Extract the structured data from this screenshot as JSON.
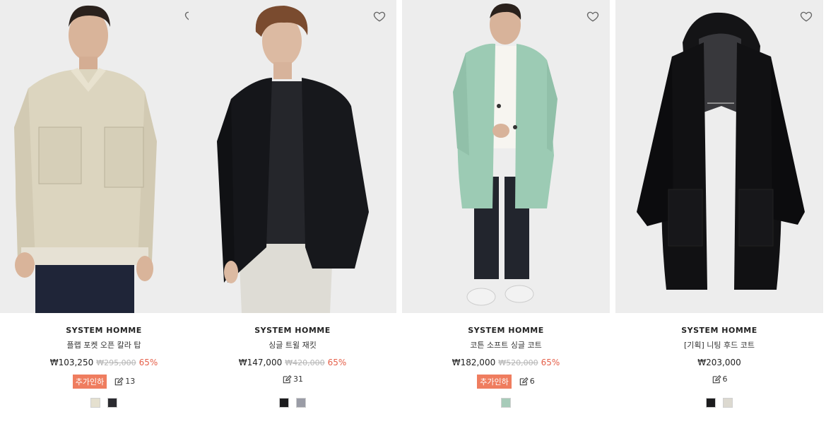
{
  "products": [
    {
      "brand": "SYSTEM HOMME",
      "name": "플랩 포켓 오픈 칼라 탑",
      "price": "₩103,250",
      "original_price": "₩295,000",
      "discount": "65%",
      "badge": "추가인하",
      "review_count": "13",
      "colors": [
        "#e5e0cf",
        "#2b2b30"
      ]
    },
    {
      "brand": "SYSTEM HOMME",
      "name": "싱글 트윌 재킷",
      "price": "₩147,000",
      "original_price": "₩420,000",
      "discount": "65%",
      "badge": "",
      "review_count": "31",
      "colors": [
        "#1c1c1e",
        "#9a9ca6"
      ]
    },
    {
      "brand": "SYSTEM HOMME",
      "name": "코튼 소프트 싱글 코트",
      "price": "₩182,000",
      "original_price": "₩520,000",
      "discount": "65%",
      "badge": "추가인하",
      "review_count": "6",
      "colors": [
        "#a7cbb9"
      ]
    },
    {
      "brand": "SYSTEM HOMME",
      "name": "[기획] 니팅 후드 코트",
      "price": "₩203,000",
      "original_price": "",
      "discount": "",
      "badge": "",
      "review_count": "6",
      "colors": [
        "#1c1c1e",
        "#dcd9d0"
      ]
    }
  ],
  "icons": {
    "wishlist": "heart-outline-icon",
    "review": "pencil-square-icon"
  }
}
